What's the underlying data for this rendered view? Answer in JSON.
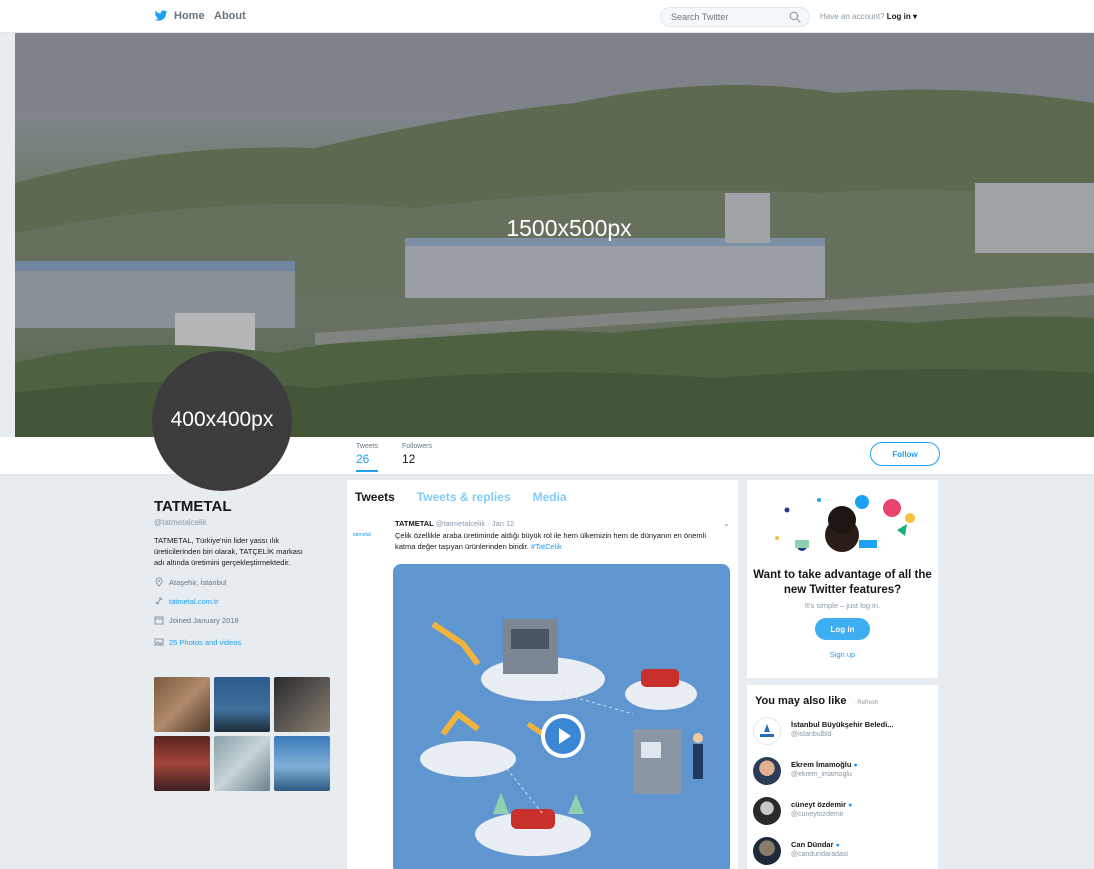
{
  "topnav": {
    "home_label": "Home",
    "about_label": "About",
    "search_placeholder": "Search Twitter",
    "login_prompt": "Have an account?",
    "login_link": "Log in ▾"
  },
  "banner": {
    "label": "1500x500px"
  },
  "avatar": {
    "label": "400x400px"
  },
  "stats": {
    "tweets_label": "Tweets",
    "tweets_value": "26",
    "followers_label": "Followers",
    "followers_value": "12",
    "follow_label": "Follow"
  },
  "profile": {
    "name": "TATMETAL",
    "handle": "@tatmetalcelik",
    "bio": "TATMETAL, Türkiye'nin lider yassı ılık üreticilerinden biri olarak, TATÇELİK markası adı altında üretimini gerçekleştirmektedir.",
    "location": "Ataşehir, İstanbul",
    "website": "tatmetal.com.tr",
    "joined": "Joined January 2018",
    "photos_link": "25 Photos and videos"
  },
  "tweets": {
    "tabs": [
      "Tweets",
      "Tweets & replies",
      "Media"
    ],
    "avatar_text": "tatmetal",
    "author": "TATMETAL",
    "handle_date": "@tatmetalcelik · Jan 12",
    "text": "Çelik özellikle araba üretiminde aldığı büyük rol ile hem ülkemizin hem de dünyanın en önemli katma değer taşıyan ürünlerinden biridir.",
    "hashtag": "#TatCelik"
  },
  "promo": {
    "title": "Want to take advantage of all the new Twitter features?",
    "subtitle": "It's simple – just log in.",
    "login_button": "Log in",
    "signup_link": "Sign up"
  },
  "suggestions": {
    "title": "You may also like",
    "refresh": "· Refresh",
    "items": [
      {
        "name": "İstanbul Büyükşehir Beledi...",
        "handle": "@istanbulbld"
      },
      {
        "name": "Ekrem İmamoğlu",
        "handle": "@ekrem_imamoglu"
      },
      {
        "name": "cüneyt özdemir",
        "handle": "@cuneytozdemir"
      },
      {
        "name": "Can Dündar",
        "handle": "@candundaradasi"
      }
    ]
  },
  "colors": {
    "accent": "#1da1f2",
    "page_bg": "#e6ecf0",
    "avatar_bg": "#3d3b3c",
    "media_bg": "#5f96d0"
  }
}
